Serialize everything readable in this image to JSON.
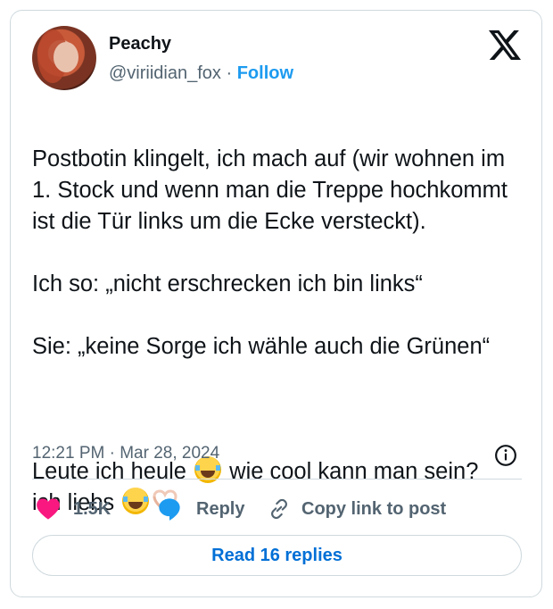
{
  "author": {
    "name": "Peachy",
    "handle": "@viriidian_fox",
    "separator": "·",
    "follow_label": "Follow"
  },
  "logo": {
    "icon": "x-logo-icon"
  },
  "tweet": {
    "line1": "Postbotin klingelt, ich mach auf (wir wohnen im 1. Stock und wenn man die Treppe hochkommt ist die Tür links um die Ecke versteckt).",
    "line2": "Ich so: „nicht erschrecken ich bin links“",
    "line3": "Sie: „keine Sorge ich wähle auch die Grünen“",
    "line4_a": "Leute ich heule ",
    "line4_b": " wie cool kann man sein? ich liebs ",
    "emoji_1": "face-with-tears-of-joy-emoji",
    "emoji_2": "heart-hands-emoji"
  },
  "timestamp": "12:21 PM · Mar 28, 2024",
  "actions": {
    "likes": "1.5K",
    "reply_label": "Reply",
    "copy_label": "Copy link to post"
  },
  "read_replies_label": "Read 16 replies",
  "colors": {
    "accent": "#1d9bf0",
    "button_text": "#006fd6",
    "like": "#f91880",
    "secondary_text": "#536471",
    "border": "#cfd9de"
  }
}
